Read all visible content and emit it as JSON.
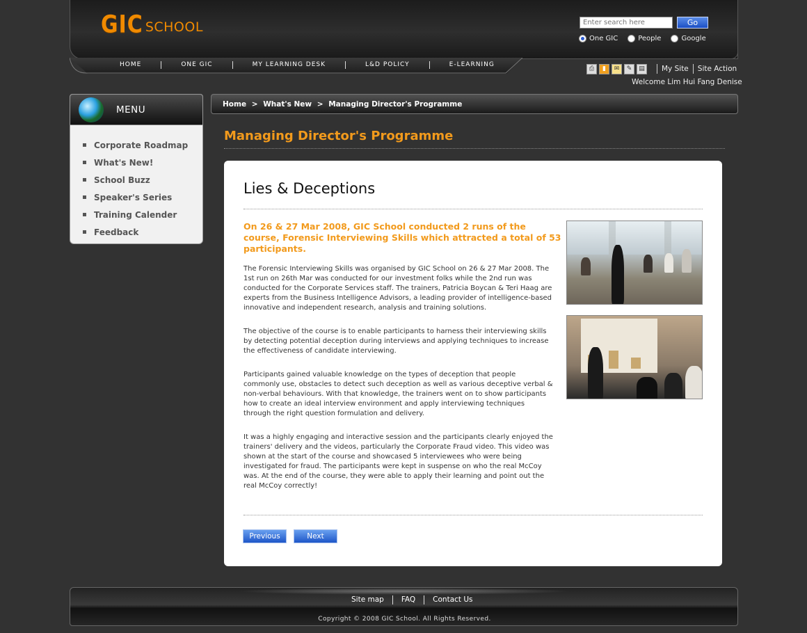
{
  "header": {
    "logo_main": "GIC",
    "logo_sub": "SCHOOL",
    "search_placeholder": "Enter search here",
    "go_label": "Go",
    "radio_options": [
      "One GIC",
      "People",
      "Google"
    ],
    "selected_option": "One GIC"
  },
  "nav": {
    "items": [
      "HOME",
      "ONE GIC",
      "MY LEARNING DESK",
      "L&D POLICY",
      "E-LEARNING"
    ]
  },
  "tools": {
    "icons": [
      "print-icon",
      "bookmark-icon",
      "email-icon",
      "edit-icon",
      "delete-icon"
    ],
    "links": [
      "My Site",
      "Site Action"
    ],
    "welcome": "Welcome Lim Hui Fang Denise"
  },
  "sidebar": {
    "title": "MENU",
    "items": [
      "Corporate Roadmap",
      "What's New!",
      "School Buzz",
      "Speaker's Series",
      "Training Calender",
      "Feedback"
    ]
  },
  "breadcrumb": {
    "items": [
      "Home",
      ">",
      "What's New",
      ">",
      "Managing Director's Programme"
    ]
  },
  "main": {
    "page_title": "Managing Director's Programme",
    "article_title": "Lies & Deceptions",
    "highlight": "On 26 & 27 Mar 2008, GIC School conducted 2 runs of the course, Forensic Interviewing Skills which attracted a total of 53 participants.",
    "paragraphs": [
      "The Forensic Interviewing Skills was organised by GIC School on 26 & 27 Mar 2008. The 1st run on 26th Mar was conducted for our investment folks while the 2nd run was conducted for the Corporate Services staff. The trainers, Patricia Boycan & Teri Haag are experts from the Business Intelligence Advisors, a leading provider of intelligence-based innovative and independent research, analysis and training solutions.",
      "The objective of the course is to enable participants to harness their interviewing skills by detecting potential deception during interviews and applying techniques to increase the effectiveness of candidate interviewing.",
      "Participants gained valuable knowledge on the types of deception that people commonly use, obstacles to detect such deception as well as various deceptive verbal & non-verbal behaviours. With that knowledge, the trainers went on to show participants how to create an ideal interview environment and apply interviewing techniques through the right question formulation and delivery.",
      "It was a highly engaging and interactive session and the participants clearly enjoyed the trainers' delivery and the videos, particularly the Corporate Fraud video. This video was shown at the start of the course and showcased 5 interviewees who were being investigated for fraud. The participants were kept in suspense on who the real McCoy was. At the end of the course, they were able to apply their learning and point out the real McCoy correctly!"
    ],
    "prev_label": "Previous",
    "next_label": "Next"
  },
  "footer": {
    "links": [
      "Site map",
      "FAQ",
      "Contact Us"
    ],
    "copyright": "Copyright © 2008 GIC School. All Rights Reserved."
  }
}
